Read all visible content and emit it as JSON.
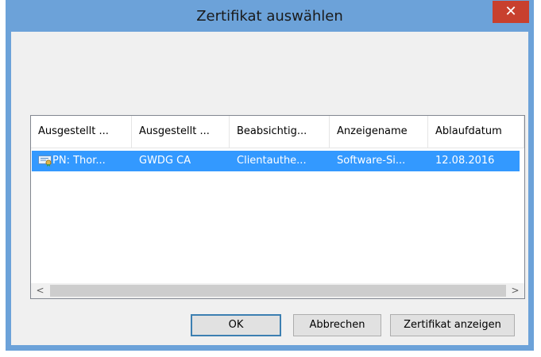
{
  "window": {
    "title": "Zertifikat auswählen",
    "close_glyph": "✕"
  },
  "list": {
    "columns": [
      {
        "label": "Ausgestellt ..."
      },
      {
        "label": "Ausgestellt ..."
      },
      {
        "label": "Beabsichtig..."
      },
      {
        "label": "Anzeigename"
      },
      {
        "label": "Ablaufdatum"
      }
    ],
    "rows": [
      {
        "icon": "certificate-icon",
        "cells": [
          "PN: Thor...",
          "GWDG CA",
          "Clientauthe...",
          "Software-Si...",
          "12.08.2016"
        ],
        "selected": true
      }
    ],
    "scroll_left_glyph": "<",
    "scroll_right_glyph": ">"
  },
  "buttons": {
    "ok": "OK",
    "cancel": "Abbrechen",
    "view_certificate": "Zertifikat anzeigen"
  },
  "colors": {
    "titlebar": "#6ca2d9",
    "close": "#c8402e",
    "selection": "#3399ff",
    "client": "#f0f0f0"
  }
}
